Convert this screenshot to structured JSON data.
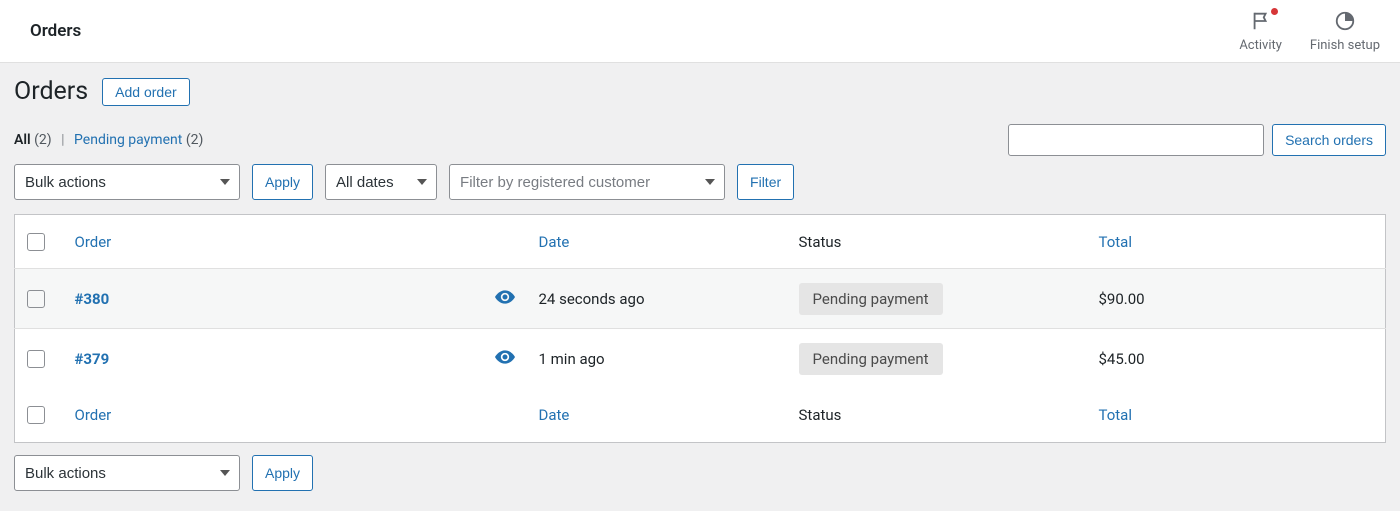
{
  "topbar": {
    "title": "Orders",
    "activity_label": "Activity",
    "finish_setup_label": "Finish setup"
  },
  "heading": "Orders",
  "add_order_label": "Add order",
  "subsub": {
    "all_label": "All",
    "all_count": "(2)",
    "pending_label": "Pending payment",
    "pending_count": "(2)"
  },
  "search": {
    "button_label": "Search orders"
  },
  "filters": {
    "bulk_actions_label": "Bulk actions",
    "apply_label": "Apply",
    "all_dates_label": "All dates",
    "customer_placeholder": "Filter by registered customer",
    "filter_label": "Filter"
  },
  "table": {
    "headers": {
      "order": "Order",
      "date": "Date",
      "status": "Status",
      "total": "Total"
    },
    "rows": [
      {
        "id": "#380",
        "date": "24 seconds ago",
        "status": "Pending payment",
        "total": "$90.00"
      },
      {
        "id": "#379",
        "date": "1 min ago",
        "status": "Pending payment",
        "total": "$45.00"
      }
    ]
  }
}
